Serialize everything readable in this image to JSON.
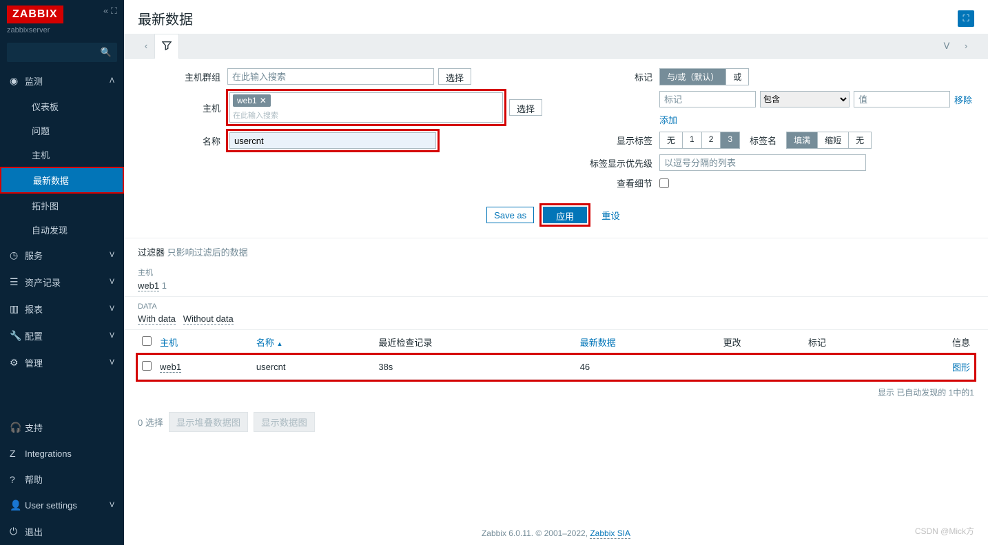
{
  "sidebar": {
    "logo": "ZABBIX",
    "server": "zabbixserver",
    "menu": {
      "monitor": {
        "label": "监测",
        "items": [
          "仪表板",
          "问题",
          "主机",
          "最新数据",
          "拓扑图",
          "自动发现"
        ]
      },
      "service": "服务",
      "asset": "资产记录",
      "report": "报表",
      "config": "配置",
      "manage": "管理"
    },
    "footer": {
      "support": "支持",
      "integrations": "Integrations",
      "help": "帮助",
      "user": "User settings",
      "logout": "退出"
    }
  },
  "page": {
    "title": "最新数据"
  },
  "filter": {
    "host_group_label": "主机群组",
    "host_group_placeholder": "在此输入搜索",
    "host_label": "主机",
    "host_tag": "web1",
    "host_placeholder": "在此输入搜索",
    "name_label": "名称",
    "name_value": "usercnt",
    "select_btn": "选择",
    "tags_label": "标记",
    "tags_andor": "与/或（默认）",
    "tags_or": "或",
    "tag_name_placeholder": "标记",
    "tag_op": "包含",
    "tag_value_placeholder": "值",
    "tag_remove": "移除",
    "tag_add": "添加",
    "show_tags_label": "显示标签",
    "show_tags_opts": [
      "无",
      "1",
      "2",
      "3"
    ],
    "tag_name_label": "标签名",
    "tag_name_opts": [
      "填满",
      "缩短",
      "无"
    ],
    "tag_priority_label": "标签显示优先级",
    "tag_priority_placeholder": "以逗号分隔的列表",
    "show_details_label": "查看细节",
    "save_as": "Save as",
    "apply": "应用",
    "reset": "重设"
  },
  "filter_info": {
    "label": "过滤器",
    "note": "只影响过滤后的数据"
  },
  "host_section": {
    "label": "主机",
    "host": "web1",
    "count": "1"
  },
  "data_section": {
    "label": "DATA",
    "with_data": "With data",
    "without_data": "Without data"
  },
  "table": {
    "headers": {
      "host": "主机",
      "name": "名称",
      "last_check": "最近检查记录",
      "last_data": "最新数据",
      "change": "更改",
      "tags": "标记",
      "info": "信息"
    },
    "row": {
      "host": "web1",
      "name": "usercnt",
      "last_check": "38s",
      "last_data": "46",
      "graph": "图形"
    }
  },
  "result_footer": "显示 已自动发现的 1中的1",
  "selection": {
    "count": "0 选择",
    "btn1": "显示堆叠数据图",
    "btn2": "显示数据图"
  },
  "footer": {
    "text": "Zabbix 6.0.11. © 2001–2022, ",
    "link": "Zabbix SIA"
  },
  "watermark": "CSDN @Mick方"
}
